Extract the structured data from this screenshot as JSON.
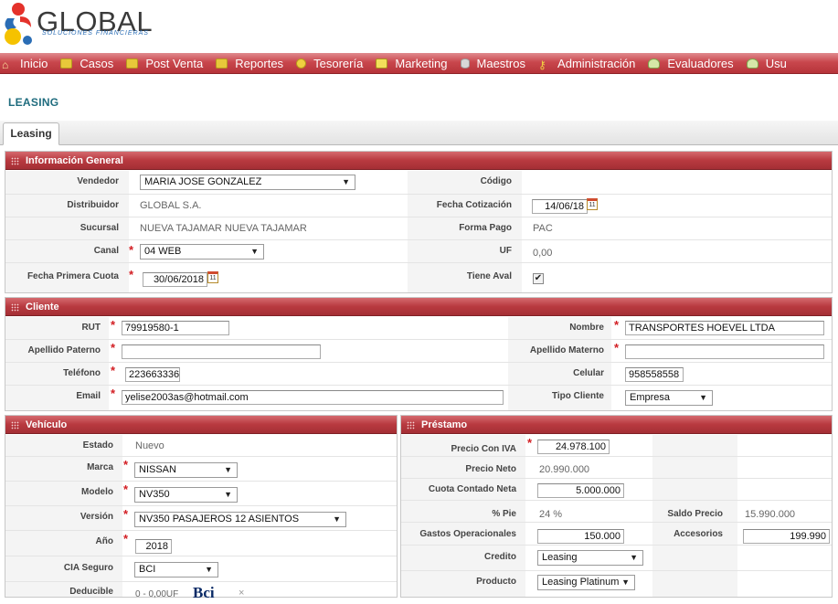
{
  "brand": {
    "name": "GLOBAL",
    "tagline": "SOLUCIONES FINANCIERAS"
  },
  "nav": [
    {
      "label": "Inicio",
      "icon": "home-icon"
    },
    {
      "label": "Casos",
      "icon": "folder-icon"
    },
    {
      "label": "Post Venta",
      "icon": "folder-icon"
    },
    {
      "label": "Reportes",
      "icon": "folder-icon"
    },
    {
      "label": "Tesorería",
      "icon": "coin-icon"
    },
    {
      "label": "Marketing",
      "icon": "monitor-icon"
    },
    {
      "label": "Maestros",
      "icon": "database-icon"
    },
    {
      "label": "Administración",
      "icon": "key-icon"
    },
    {
      "label": "Evaluadores",
      "icon": "users-icon"
    },
    {
      "label": "Usu",
      "icon": "users-icon"
    }
  ],
  "page_title": "LEASING",
  "tab": "Leasing",
  "general": {
    "title": "Información General",
    "vendedor_label": "Vendedor",
    "vendedor": "MARIA JOSE GONZALEZ",
    "codigo_label": "Código",
    "distribuidor_label": "Distribuidor",
    "distribuidor": "GLOBAL S.A.",
    "fecha_cot_label": "Fecha Cotización",
    "fecha_cot": "14/06/18",
    "sucursal_label": "Sucursal",
    "sucursal": "NUEVA TAJAMAR NUEVA TAJAMAR",
    "forma_pago_label": "Forma Pago",
    "forma_pago": "PAC",
    "canal_label": "Canal",
    "canal": "04 WEB",
    "uf_label": "UF",
    "uf": "0,00",
    "fecha_cuota_label": "Fecha Primera Cuota",
    "fecha_cuota": "30/06/2018",
    "aval_label": "Tiene Aval",
    "aval_checked": true
  },
  "cliente": {
    "title": "Cliente",
    "rut_label": "RUT",
    "rut": "79919580-1",
    "nombre_label": "Nombre",
    "nombre": "TRANSPORTES HOEVEL LTDA",
    "ap_paterno_label": "Apellido Paterno",
    "ap_paterno": "",
    "ap_materno_label": "Apellido Materno",
    "ap_materno": "",
    "telefono_label": "Teléfono",
    "telefono": "223663336",
    "celular_label": "Celular",
    "celular": "958558558",
    "email_label": "Email",
    "email": "yelise2003as@hotmail.com",
    "tipo_label": "Tipo Cliente",
    "tipo": "Empresa"
  },
  "vehiculo": {
    "title": "Vehículo",
    "estado_label": "Estado",
    "estado": "Nuevo",
    "marca_label": "Marca",
    "marca": "NISSAN",
    "modelo_label": "Modelo",
    "modelo": "NV350",
    "version_label": "Versión",
    "version": "NV350 PASAJEROS 12 ASIENTOS",
    "anio_label": "Año",
    "anio": "2018",
    "cia_label": "CIA Seguro",
    "cia": "BCI",
    "deducible_label": "Deducible",
    "deducible": "0 - 0,00UF",
    "insurer_logo": "Bci"
  },
  "prestamo": {
    "title": "Préstamo",
    "precio_iva_label": "Precio Con IVA",
    "precio_iva": "24.978.100",
    "precio_neto_label": "Precio Neto",
    "precio_neto": "20.990.000",
    "cuota_contado_label": "Cuota Contado Neta",
    "cuota_contado": "5.000.000",
    "pie_label": "% Pie",
    "pie": "24 %",
    "saldo_label": "Saldo Precio",
    "saldo": "15.990.000",
    "gastos_label": "Gastos Operacionales",
    "gastos": "150.000",
    "accesorios_label": "Accesorios",
    "accesorios": "199.990",
    "credito_label": "Credito",
    "credito": "Leasing",
    "producto_label": "Producto",
    "producto": "Leasing Platinum"
  },
  "colors": {
    "accent": "#b6343a",
    "title": "#1f6c7e",
    "required": "#d21d22"
  }
}
